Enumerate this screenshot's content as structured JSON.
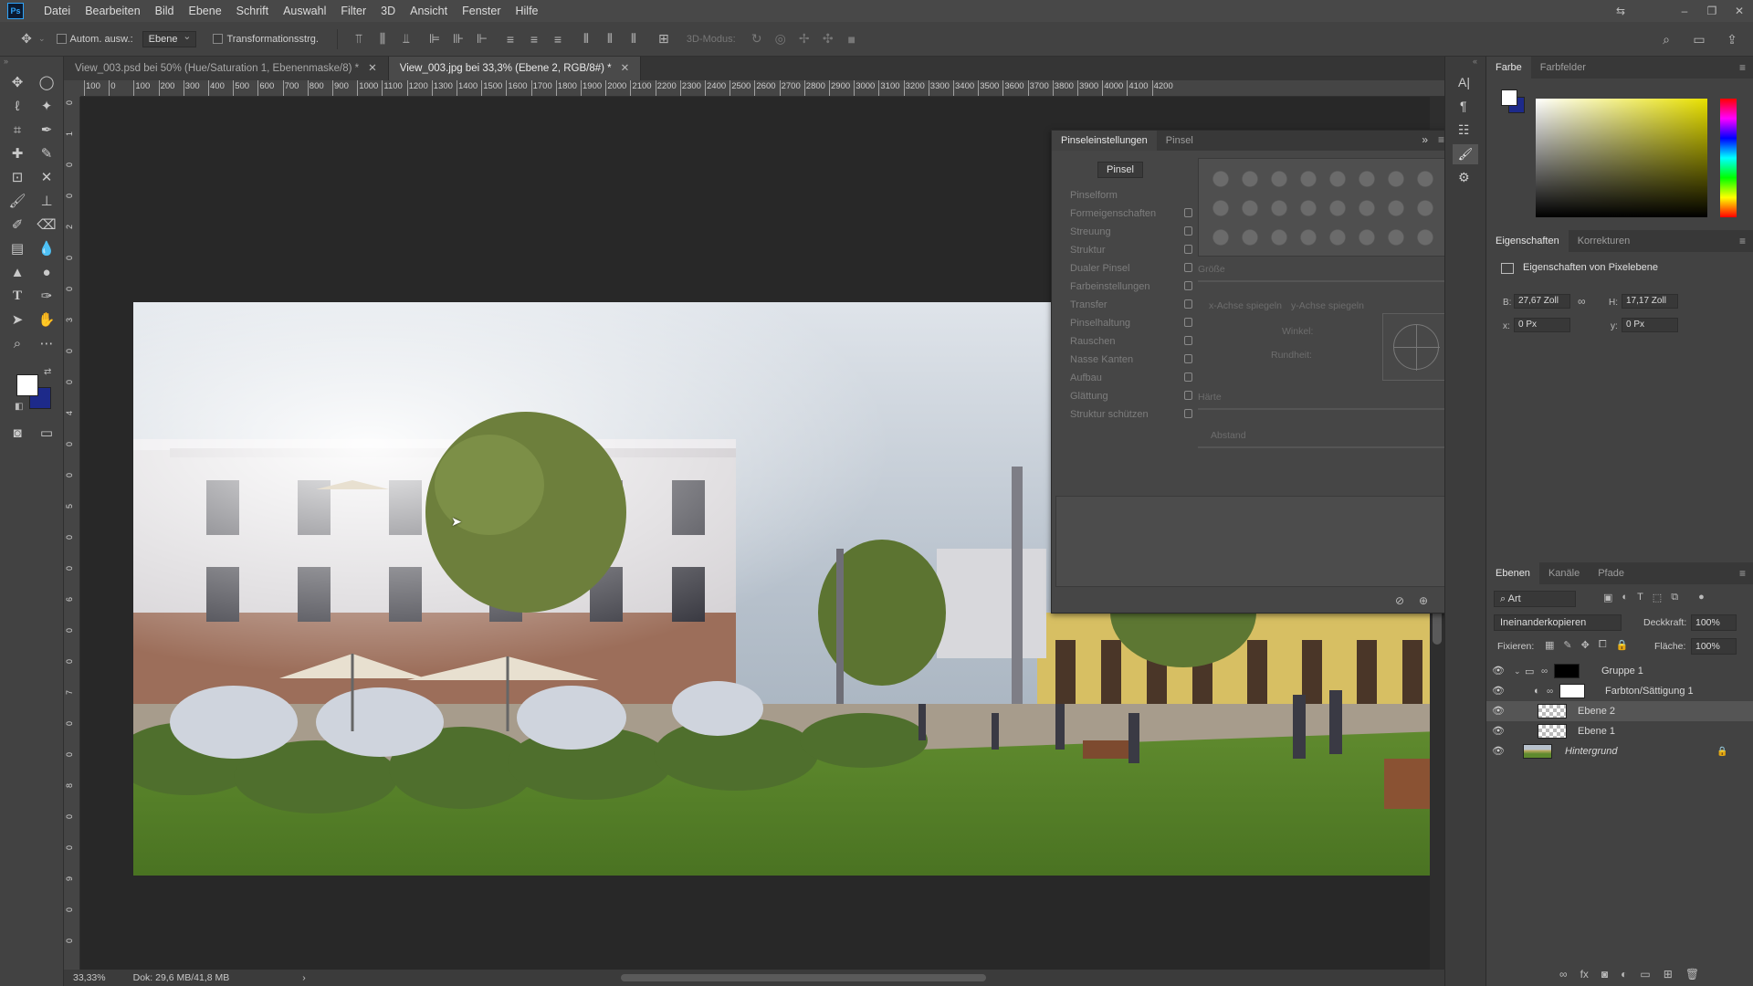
{
  "app": {
    "logo": "Ps"
  },
  "menu": [
    "Datei",
    "Bearbeiten",
    "Bild",
    "Ebene",
    "Schrift",
    "Auswahl",
    "Filter",
    "3D",
    "Ansicht",
    "Fenster",
    "Hilfe"
  ],
  "window_controls": {
    "minimize": "–",
    "restore": "❐",
    "close": "✕",
    "extra": "⇆"
  },
  "options_bar": {
    "auto_select_label": "Autom. ausw.:",
    "auto_select_value": "Ebene",
    "transform_label": "Transformationsstrg.",
    "mode_3d": "3D-Modus:"
  },
  "tabs": [
    {
      "label": "View_003.psd bei 50% (Hue/Saturation 1, Ebenenmaske/8) *",
      "close": "✕"
    },
    {
      "label": "View_003.jpg bei 33,3% (Ebene 2, RGB/8#) *",
      "close": "✕"
    }
  ],
  "ruler_top": [
    "100",
    "0",
    "100",
    "200",
    "300",
    "400",
    "500",
    "600",
    "700",
    "800",
    "900",
    "1000",
    "1100",
    "1200",
    "1300",
    "1400",
    "1500",
    "1600",
    "1700",
    "1800",
    "1900",
    "2000",
    "2100",
    "2200",
    "2300",
    "2400",
    "2500",
    "2600",
    "2700",
    "2800",
    "2900",
    "3000",
    "3100",
    "3200",
    "3300",
    "3400",
    "3500",
    "3600",
    "3700",
    "3800",
    "3900",
    "4000",
    "4100",
    "4200"
  ],
  "ruler_left": [
    "0",
    "1",
    "0",
    "0",
    "2",
    "0",
    "0",
    "3",
    "0",
    "0",
    "4",
    "0",
    "0",
    "5",
    "0",
    "0",
    "6",
    "0",
    "0",
    "7",
    "0",
    "0",
    "8",
    "0",
    "0",
    "9",
    "0",
    "0"
  ],
  "status": {
    "zoom": "33,33%",
    "doc": "Dok: 29,6 MB/41,8 MB",
    "arrow": "›"
  },
  "brush_panel": {
    "tabs": [
      "Pinseleinstellungen",
      "Pinsel"
    ],
    "collapse": "»",
    "pinsel_button": "Pinsel",
    "options": [
      "Pinselform",
      "Formeigenschaften",
      "Streuung",
      "Struktur",
      "Dualer Pinsel",
      "Farbeinstellungen",
      "Transfer",
      "Pinselhaltung",
      "Rauschen",
      "Nasse Kanten",
      "Aufbau",
      "Glättung",
      "Struktur schützen"
    ],
    "size_label": "Größe",
    "flip_x": "x-Achse spiegeln",
    "flip_y": "y-Achse spiegeln",
    "angle_label": "Winkel:",
    "roundness_label": "Rundheit:",
    "hardness_label": "Härte",
    "spacing_label": "Abstand"
  },
  "color_panel": {
    "tabs": [
      "Farbe",
      "Farbfelder"
    ],
    "fg": "#ffffff",
    "bg": "#1d2a8a"
  },
  "properties_panel": {
    "tabs": [
      "Eigenschaften",
      "Korrekturen"
    ],
    "title": "Eigenschaften von Pixelebene",
    "w_label": "B:",
    "w_value": "27,67 Zoll",
    "h_label": "H:",
    "h_value": "17,17 Zoll",
    "x_label": "x:",
    "x_value": "0 Px",
    "y_label": "y:",
    "y_value": "0 Px",
    "link": "∞"
  },
  "layers_panel": {
    "tabs": [
      "Ebenen",
      "Kanäle",
      "Pfade"
    ],
    "filter": "Art",
    "blend_mode": "Ineinanderkopieren",
    "opacity_label": "Deckkraft:",
    "opacity_value": "100%",
    "lock_label": "Fixieren:",
    "fill_label": "Fläche:",
    "fill_value": "100%",
    "layers": [
      {
        "name": "Gruppe 1",
        "type": "group"
      },
      {
        "name": "Farbton/Sättigung 1",
        "type": "adjustment"
      },
      {
        "name": "Ebene 2",
        "type": "pixel",
        "selected": true
      },
      {
        "name": "Ebene 1",
        "type": "pixel"
      },
      {
        "name": "Hintergrund",
        "type": "background"
      }
    ]
  }
}
